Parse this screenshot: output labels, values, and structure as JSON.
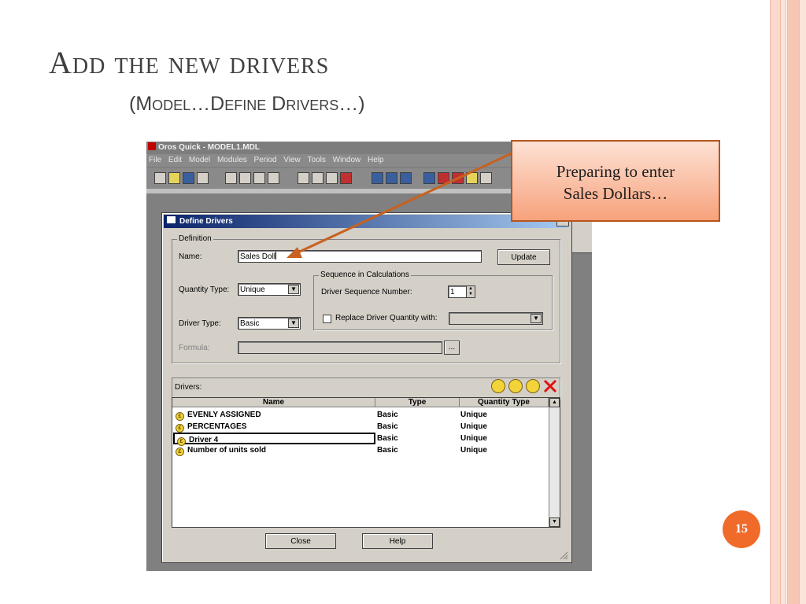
{
  "slide": {
    "title": "Add the new drivers",
    "subtitle": "(Model…Define Drivers…)",
    "page_number": "15",
    "callout_line1": "Preparing to enter",
    "callout_line2": "Sales Dollars…"
  },
  "app": {
    "title": "Oros Quick - MODEL1.MDL",
    "menu": [
      "File",
      "Edit",
      "Model",
      "Modules",
      "Period",
      "View",
      "Tools",
      "Window",
      "Help"
    ]
  },
  "dialog": {
    "title": "Define Drivers",
    "definition_group": "Definition",
    "name_label": "Name:",
    "name_value": "Sales Doll",
    "update_button": "Update",
    "quantity_type_label": "Quantity Type:",
    "quantity_type_value": "Unique",
    "driver_type_label": "Driver Type:",
    "driver_type_value": "Basic",
    "formula_label": "Formula:",
    "formula_button": "...",
    "sequence_group": "Sequence in Calculations",
    "sequence_label": "Driver Sequence Number:",
    "sequence_value": "1",
    "replace_label": "Replace Driver Quantity with:",
    "drivers_label": "Drivers:",
    "columns": [
      "Name",
      "Type",
      "Quantity Type"
    ],
    "rows": [
      {
        "name": "EVENLY ASSIGNED",
        "type": "Basic",
        "qty": "Unique"
      },
      {
        "name": "PERCENTAGES",
        "type": "Basic",
        "qty": "Unique"
      },
      {
        "name": "Driver 4",
        "type": "Basic",
        "qty": "Unique"
      },
      {
        "name": "Number of units sold",
        "type": "Basic",
        "qty": "Unique"
      }
    ],
    "close_button": "Close",
    "help_button": "Help"
  }
}
